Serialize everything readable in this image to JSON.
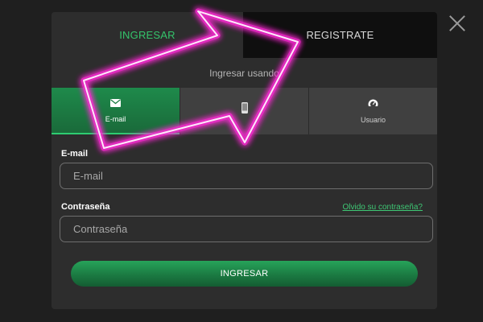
{
  "tabs": {
    "login_label": "INGRESAR",
    "register_label": "REGISTRATE"
  },
  "login_method": {
    "heading": "Ingresar usando",
    "options": [
      {
        "label": "E-mail",
        "icon": "envelope-icon",
        "active": true
      },
      {
        "label": "",
        "icon": "mobile-phone-icon",
        "active": false
      },
      {
        "label": "Usuario",
        "icon": "speedometer-icon",
        "active": false
      }
    ]
  },
  "email_field": {
    "label": "E-mail",
    "placeholder": "E-mail",
    "value": ""
  },
  "password_field": {
    "label": "Contraseña",
    "placeholder": "Contraseña",
    "value": ""
  },
  "forgot_password_label": "Olvido su contraseña?",
  "submit_label": "INGRESAR",
  "colors": {
    "accent_green": "#34c46b",
    "overlay_arrow": "#ff2bd6"
  },
  "overlay": {
    "icon": "magenta-arrow-pointing-to-register-tab"
  }
}
